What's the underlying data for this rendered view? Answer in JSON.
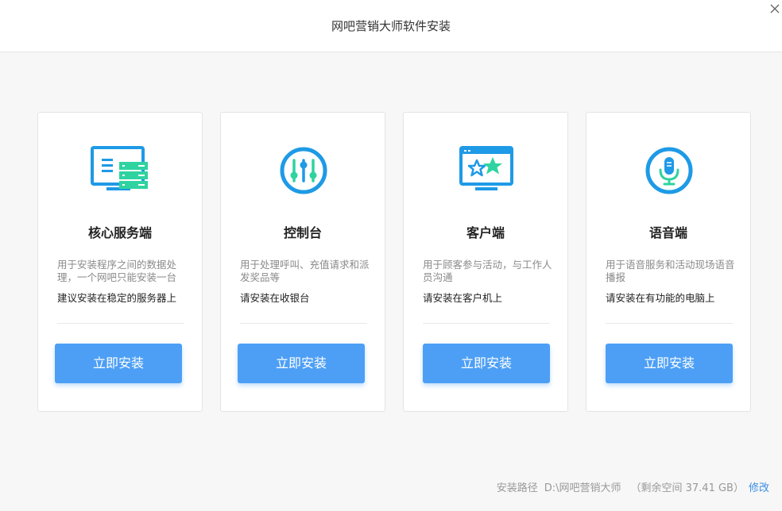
{
  "window": {
    "title": "网吧营销大师软件安装"
  },
  "colors": {
    "accent": "#4d9ff5",
    "icon_blue": "#1e9ae6",
    "icon_green": "#2fd3a0"
  },
  "cards": [
    {
      "title": "核心服务端",
      "desc": "用于安装程序之间的数据处理，一个网吧只能安装一台",
      "note": "建议安装在稳定的服务器上",
      "button": "立即安装",
      "icon": "server-icon"
    },
    {
      "title": "控制台",
      "desc": "用于处理呼叫、充值请求和派发奖品等",
      "note": "请安装在收银台",
      "button": "立即安装",
      "icon": "sliders-icon"
    },
    {
      "title": "客户端",
      "desc": "用于顾客参与活动，与工作人员沟通",
      "note": "请安装在客户机上",
      "button": "立即安装",
      "icon": "monitor-stars-icon"
    },
    {
      "title": "语音端",
      "desc": "用于语音服务和活动现场语音播报",
      "note": "请安装在有功能的电脑上",
      "button": "立即安装",
      "icon": "microphone-icon"
    }
  ],
  "footer": {
    "path_label": "安装路径",
    "path_value": "D:\\网吧营销大师",
    "free_space": "（剩余空间 37.41 GB）",
    "modify": "修改"
  }
}
